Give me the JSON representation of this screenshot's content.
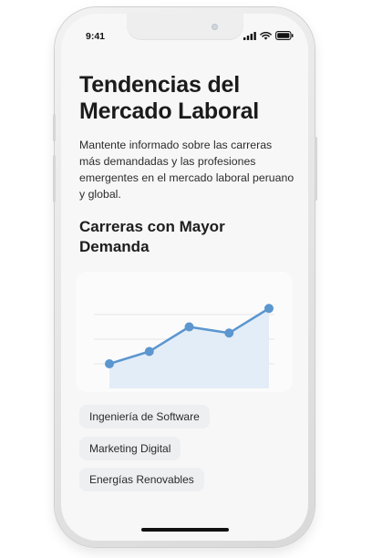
{
  "status": {
    "time": "9:41"
  },
  "header": {
    "title_line1": "Tendencias del",
    "title_line2": "Mercado Laboral",
    "description": "Mantente informado sobre las carreras más demandadas y las profesiones emergentes en el mercado laboral peruano y global."
  },
  "section": {
    "title_line1": "Carreras con Mayor",
    "title_line2": "Demanda"
  },
  "chart_data": {
    "type": "area",
    "x": [
      1,
      2,
      3,
      4,
      5
    ],
    "values": [
      2,
      3,
      5,
      4.5,
      6.5
    ],
    "ylim": [
      0,
      8
    ],
    "grid": true,
    "line_color": "#5b96cf",
    "fill_color": "#e3edf7"
  },
  "tags": [
    {
      "label": "Ingeniería de Software"
    },
    {
      "label": "Marketing Digital"
    },
    {
      "label": "Energías Renovables"
    }
  ]
}
